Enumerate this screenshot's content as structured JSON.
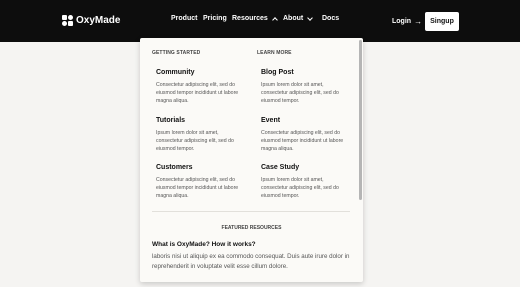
{
  "navbar": {
    "brand": "OxyMade",
    "links": [
      {
        "label": "Product"
      },
      {
        "label": "Pricing"
      },
      {
        "label": "Resources",
        "expanded": true
      },
      {
        "label": "About"
      },
      {
        "label": "Docs"
      }
    ],
    "login": "Login",
    "login_arrow": "→",
    "signup": "Singup"
  },
  "dropdown": {
    "columns": [
      {
        "heading": "GETTING STARTED",
        "items": [
          {
            "title": "Community",
            "desc": "Consectetur adipiscing elit, sed do eiusmod tempor incididunt ut labore magna aliqua."
          },
          {
            "title": "Tutorials",
            "desc": "Ipsum lorem dolor sit amet, consectetur adipiscing elit, sed do eiusmod tempor."
          },
          {
            "title": "Customers",
            "desc": "Consectetur adipiscing elit, sed do eiusmod tempor incididunt ut labore magna aliqua."
          }
        ]
      },
      {
        "heading": "LEARN MORE",
        "items": [
          {
            "title": "Blog Post",
            "desc": "Ipsum lorem dolor sit amet, consectetur adipiscing elit, sed do eiusmod tempor."
          },
          {
            "title": "Event",
            "desc": "Consectetur adipiscing elit, sed do eiusmod tempor incididunt ut labore magna aliqua."
          },
          {
            "title": "Case Study",
            "desc": "Ipsum lorem dolor sit amet, consectetur adipiscing elit, sed do eiusmod tempor."
          }
        ]
      }
    ],
    "featured": {
      "heading": "FEATURED RESOURCES",
      "title": "What is OxyMade? How it works?",
      "desc": "laboris nisi ut aliquip ex ea commodo consequat. Duis aute irure dolor in reprehenderit in voluptate velit esse cillum dolore."
    }
  },
  "colors": {
    "navbar_bg": "#0d0d0d",
    "page_bg": "#f5f4f2",
    "panel_bg": "#fbfaf7"
  }
}
